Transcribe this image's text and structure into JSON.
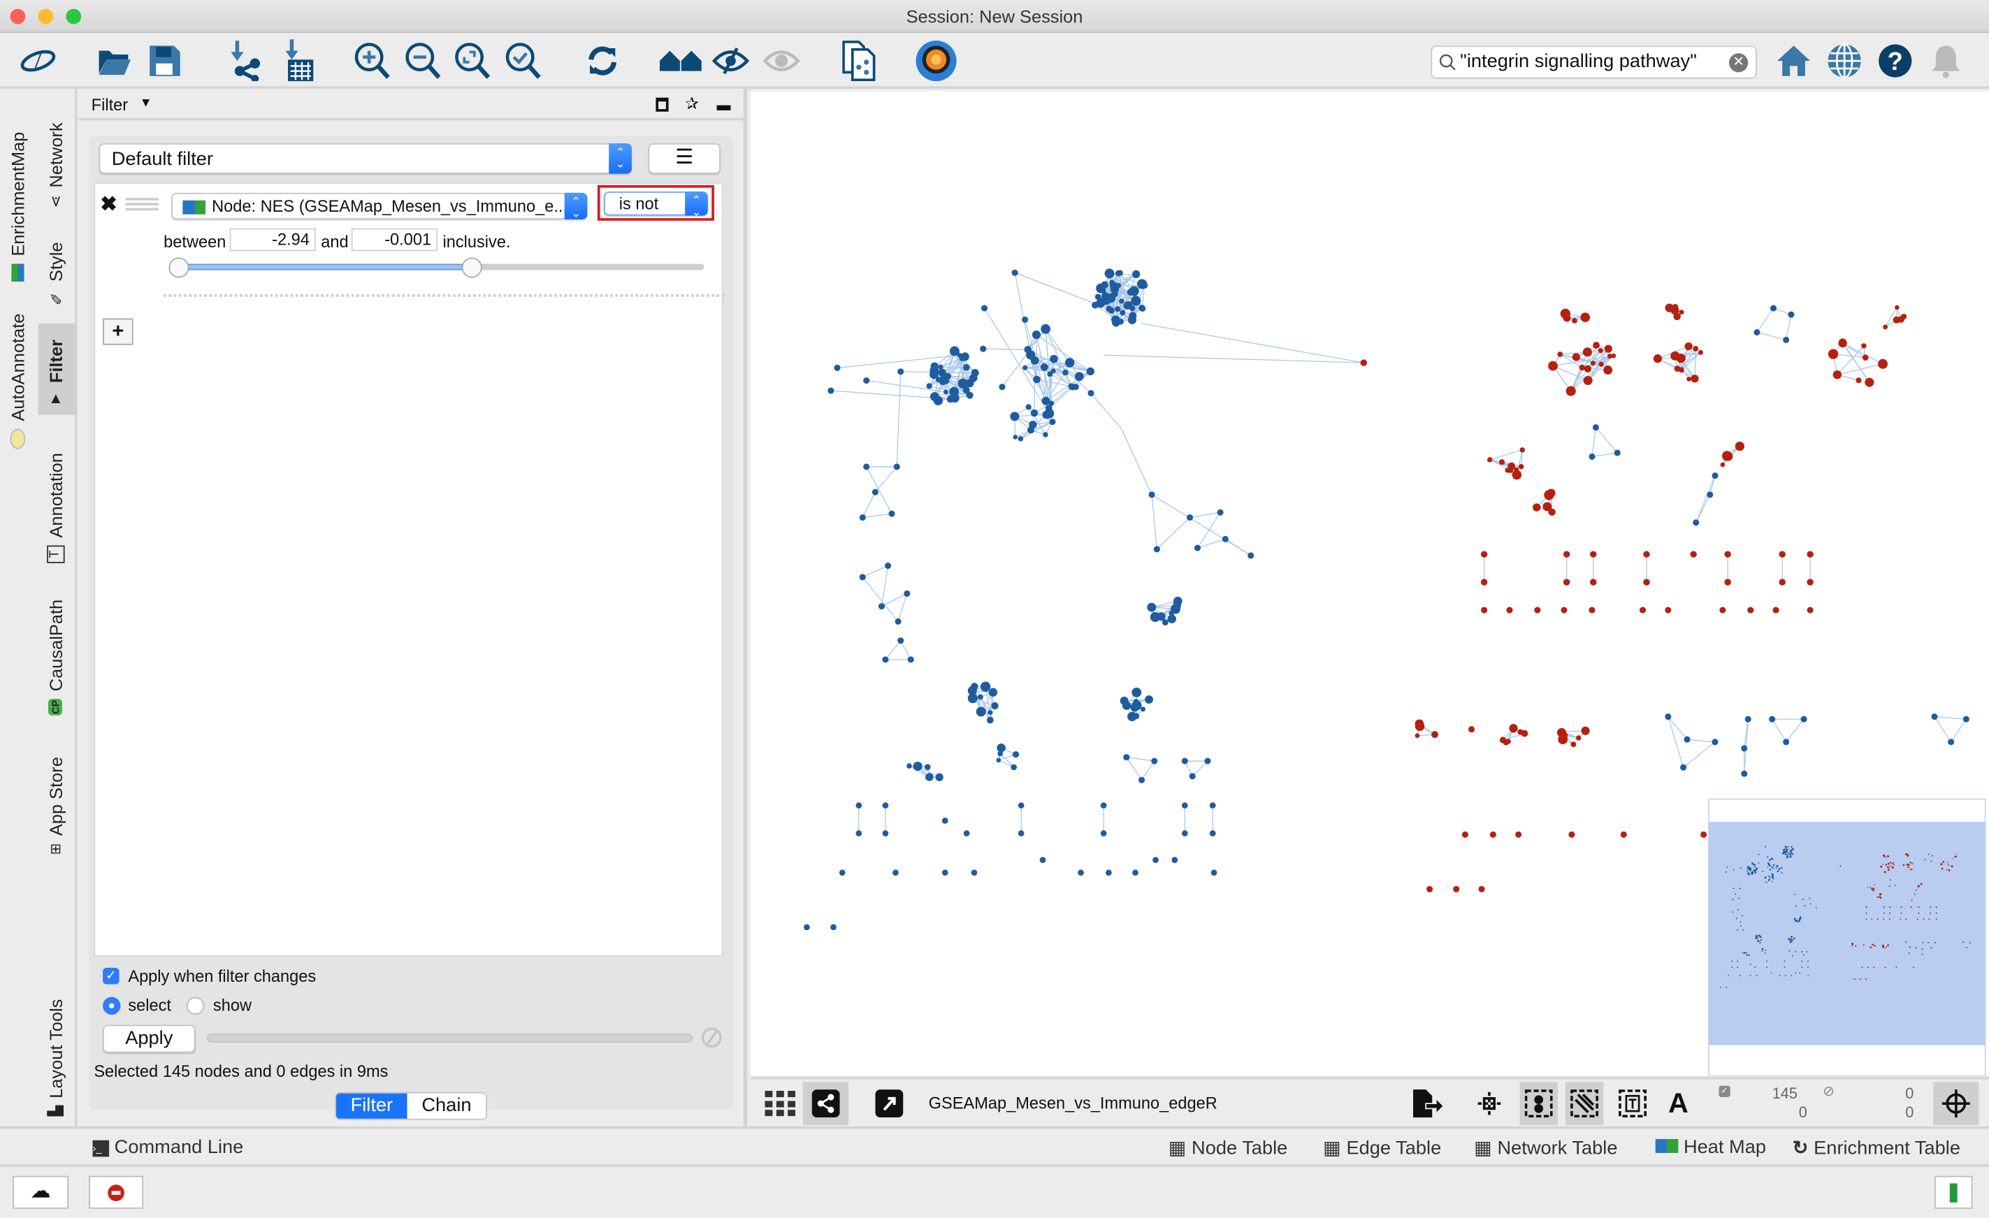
{
  "window": {
    "title": "Session: New Session"
  },
  "toolbar": {
    "icons": [
      "cytoscape-logo-icon",
      "open-session-icon",
      "save-session-icon",
      "import-network-icon",
      "import-table-icon",
      "zoom-in-icon",
      "zoom-out-icon",
      "zoom-fit-icon",
      "zoom-selected-icon",
      "refresh-icon",
      "home-network-icon",
      "hide-selected-icon",
      "show-all-icon",
      "new-network-from-selection-icon",
      "enrichment-search-icon",
      "home-icon",
      "globe-icon",
      "help-icon",
      "notification-bell-icon"
    ],
    "search_value": "\"integrin signalling pathway\""
  },
  "side_tabs": {
    "enrichmentmap": "EnrichmentMap",
    "autoannotate": "AutoAnnotate",
    "network": "Network",
    "style": "Style",
    "filter": "Filter",
    "annotation": "Annotation",
    "causalpath": "CausalPath",
    "causalpath_badge": "CP",
    "appstore": "App Store",
    "layouttools": "Layout Tools"
  },
  "filter_panel": {
    "title": "Filter",
    "filter_select": "Default filter",
    "condition": {
      "column": "Node: NES (GSEAMap_Mesen_vs_Immuno_e...",
      "operator": "is not",
      "between_label": "between",
      "min": "-2.94",
      "and_label": "and",
      "max": "-0.001",
      "inclusive_label": "inclusive.",
      "range_low_fraction": 0.0,
      "range_high_fraction": 0.56
    },
    "add_button": "+",
    "apply_when_changes": {
      "label": "Apply when filter changes",
      "checked": true
    },
    "mode_options": [
      {
        "label": "select",
        "selected": true
      },
      {
        "label": "show",
        "selected": false
      }
    ],
    "apply_button": "Apply",
    "status": "Selected 145 nodes and 0 edges in 9ms",
    "tabs": [
      {
        "label": "Filter",
        "active": true
      },
      {
        "label": "Chain",
        "active": false
      }
    ]
  },
  "network_view": {
    "network_name": "GSEAMap_Mesen_vs_Immuno_edgeR",
    "selected_nodes": "145",
    "selected_edges": "0",
    "hidden_nodes": "0",
    "hidden_edges": "0",
    "colors": {
      "positive_node": "#b5200f",
      "negative_node": "#1f5b9e",
      "edge": "#a9c8e8",
      "minimap_viewport": "#b9cdf1"
    }
  },
  "bottom_tabs": {
    "command_line": "Command Line",
    "node_table": "Node Table",
    "edge_table": "Edge Table",
    "network_table": "Network Table",
    "heat_map": "Heat Map",
    "enrichment_table": "Enrichment Table"
  }
}
